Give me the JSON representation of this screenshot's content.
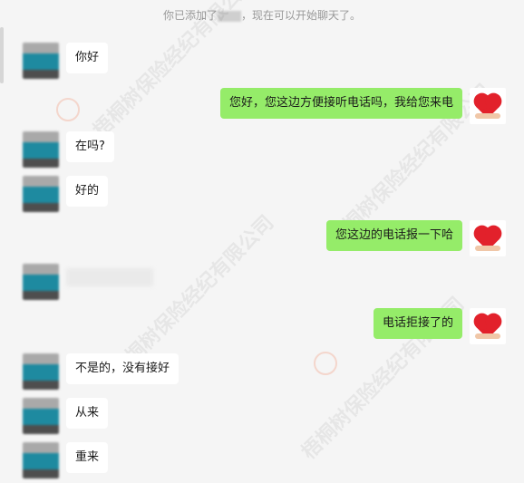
{
  "system_notice": {
    "prefix": "你已添加了",
    "suffix": "，现在可以开始聊天了。"
  },
  "watermark": "梧桐树保险经纪有限公司",
  "messages": [
    {
      "side": "left",
      "text": "你好"
    },
    {
      "side": "right",
      "text": "您好，您这边方便接听电话吗，我给您来电"
    },
    {
      "side": "left",
      "text": "在吗?"
    },
    {
      "side": "left",
      "text": "好的"
    },
    {
      "side": "right",
      "text": "您这边的电话报一下哈"
    },
    {
      "side": "left",
      "text": ""
    },
    {
      "side": "right",
      "text": "电话拒接了的"
    },
    {
      "side": "left",
      "text": "不是的，没有接好"
    },
    {
      "side": "left",
      "text": "从来"
    },
    {
      "side": "left",
      "text": "重来"
    }
  ]
}
